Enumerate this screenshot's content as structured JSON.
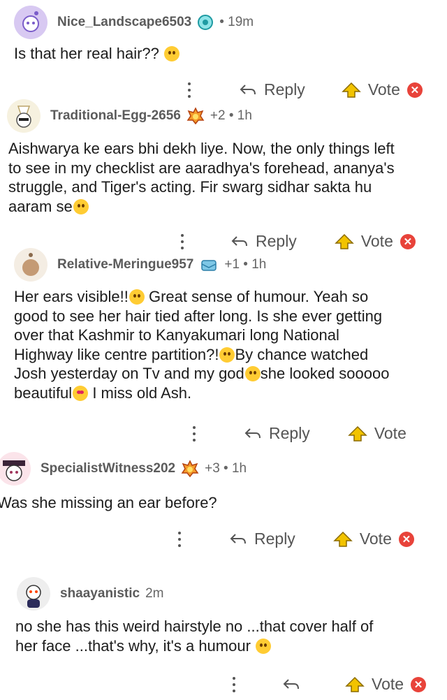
{
  "comments": [
    {
      "username": "Nice_Landscape6503",
      "meta": "• 19m",
      "lines": [
        "Is that her real hair??"
      ],
      "reply_label": "Reply",
      "vote_label": "Vote"
    },
    {
      "username": "Traditional-Egg-2656",
      "meta": "+2 • 1h",
      "lines": [
        "Aishwarya ke ears bhi dekh liye. Now, the only things left",
        "to see in my checklist are aaradhya's forehead, ananya's",
        "struggle, and Tiger's acting. Fir swarg sidhar sakta hu",
        "aaram se"
      ],
      "reply_label": "Reply",
      "vote_label": "Vote"
    },
    {
      "username": "Relative-Meringue957",
      "meta": "+1 • 1h",
      "lines": [
        "Her ears visible!!",
        "Great sense of humour. Yeah so",
        "good to see her hair tied after long. Is she ever getting",
        "over that Kashmir to Kanyakumari long National",
        "Highway like centre partition?!",
        "By chance watched",
        "Josh yesterday on Tv and my god",
        "she looked sooooo",
        "beautiful",
        "I miss old Ash."
      ],
      "reply_label": "Reply",
      "vote_label": "Vote"
    },
    {
      "username": "SpecialistWitness202",
      "meta": "+3 • 1h",
      "lines": [
        "Was she missing an ear before?"
      ],
      "reply_label": "Reply",
      "vote_label": "Vote"
    },
    {
      "username": "shaayanistic",
      "meta": "2m",
      "lines": [
        "no she has this weird hairstyle no ...that cover half of",
        "her face ...that's why, it's a humour"
      ],
      "reply_label": "Reply",
      "vote_label": "Vote"
    }
  ],
  "icons": {
    "more": "more-vertical-icon",
    "reply": "reply-arrow-icon",
    "vote": "vote-arrow-icon",
    "close": "close-icon"
  },
  "colors": {
    "vote_arrow": "#f2c300",
    "close": "#e8433a"
  }
}
